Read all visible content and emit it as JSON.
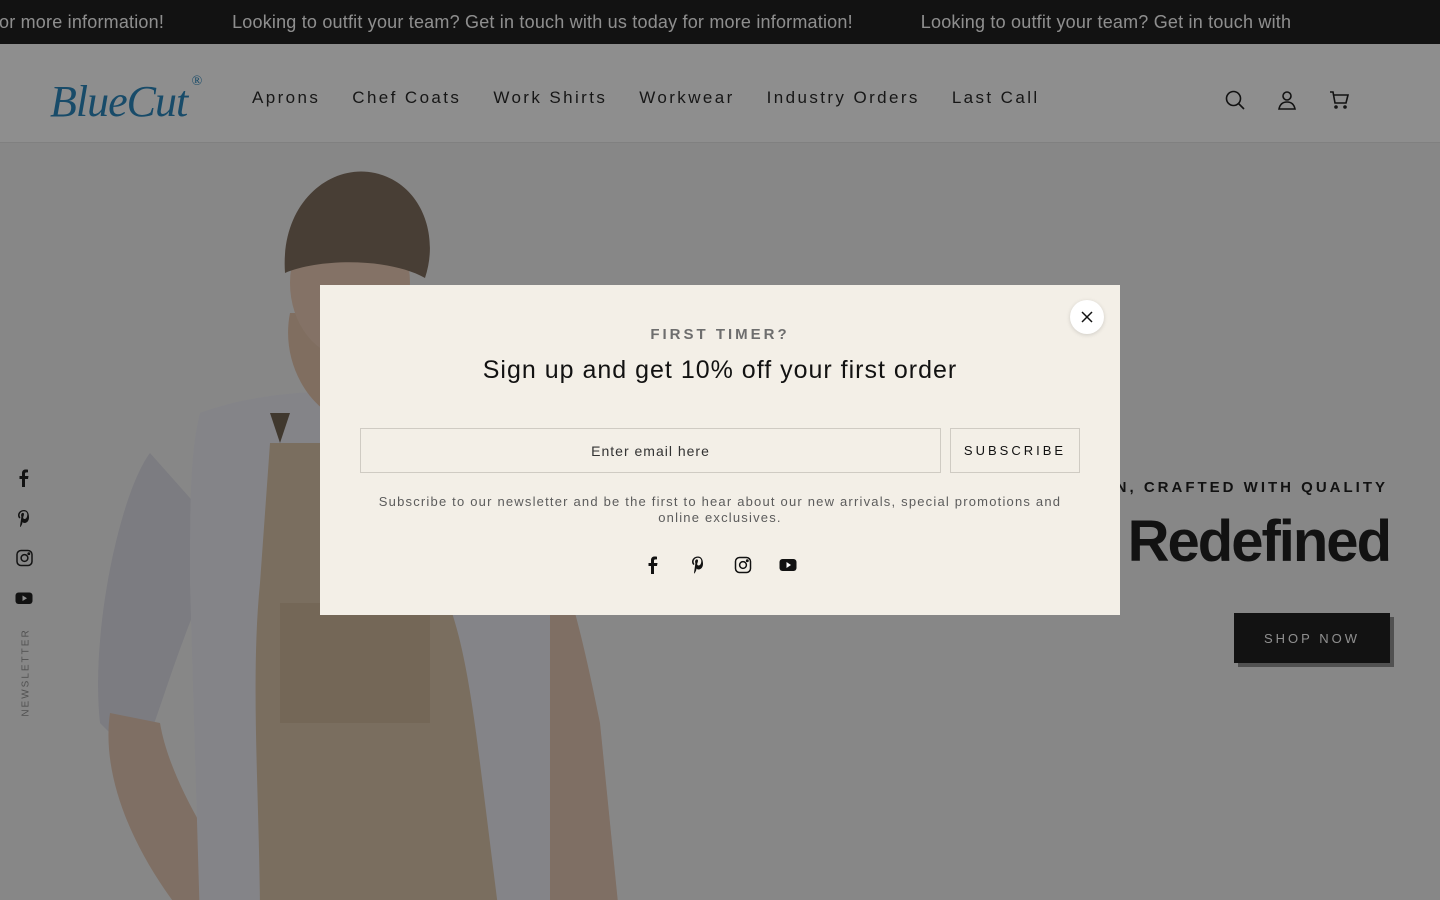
{
  "announcement": {
    "text_1": "or more information!",
    "text_2": "Looking to outfit your team? Get in touch with us today for more information!",
    "text_3": "Looking to outfit your team? Get in touch with"
  },
  "header": {
    "logo": "BlueCut",
    "logo_mark": "®",
    "nav": [
      "Aprons",
      "Chef Coats",
      "Work Shirts",
      "Workwear",
      "Industry Orders",
      "Last Call"
    ],
    "icons": [
      "search-icon",
      "account-icon",
      "cart-icon"
    ]
  },
  "hero": {
    "subtitle": "ON, CRAFTED WITH QUALITY",
    "title": "s Redefined",
    "cta": "SHOP NOW",
    "side_social": [
      "facebook-icon",
      "pinterest-icon",
      "instagram-icon",
      "youtube-icon"
    ],
    "side_label": "NEWSLETTER"
  },
  "modal": {
    "kicker": "FIRST TIMER?",
    "title": "Sign up and get 10% off your first order",
    "email_placeholder": "Enter email here",
    "subscribe": "SUBSCRIBE",
    "description": "Subscribe to our newsletter and be the first to hear about our new arrivals, special promotions and online exclusives.",
    "social": [
      "facebook-icon",
      "pinterest-icon",
      "instagram-icon",
      "youtube-icon"
    ]
  },
  "colors": {
    "brand": "#1e7fb8",
    "dark": "#121212",
    "modal_bg": "#f3efe7"
  }
}
